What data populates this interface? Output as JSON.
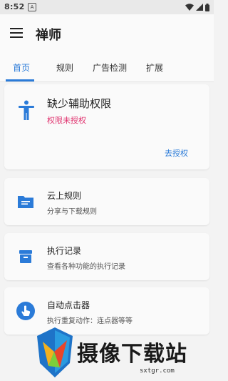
{
  "status": {
    "time": "8:52",
    "notification_badge": "A",
    "icons": [
      "wifi-icon",
      "signal-icon",
      "battery-icon"
    ]
  },
  "appbar": {
    "title": "禅师",
    "menu_icon": "hamburger-menu-icon"
  },
  "tabs": [
    {
      "label": "首页",
      "active": true
    },
    {
      "label": "规则",
      "active": false
    },
    {
      "label": "广告检测",
      "active": false
    },
    {
      "label": "扩展",
      "active": false
    }
  ],
  "permission_card": {
    "title": "缺少辅助权限",
    "subtitle": "权限未授权",
    "action_label": "去授权",
    "icon": "accessibility-icon"
  },
  "cards": [
    {
      "title": "云上规则",
      "subtitle": "分享与下载规则",
      "icon": "folder-icon"
    },
    {
      "title": "执行记录",
      "subtitle": "查看各种功能的执行记录",
      "icon": "archive-icon"
    },
    {
      "title": "自动点击器",
      "subtitle": "执行重复动作：连点器等等",
      "icon": "touch-icon"
    }
  ],
  "watermark": {
    "text": "摄像下载站",
    "url": "sxtgr.com"
  },
  "colors": {
    "accent": "#2b7bd8",
    "warning": "#e0336f",
    "background": "#f3f3f3"
  }
}
